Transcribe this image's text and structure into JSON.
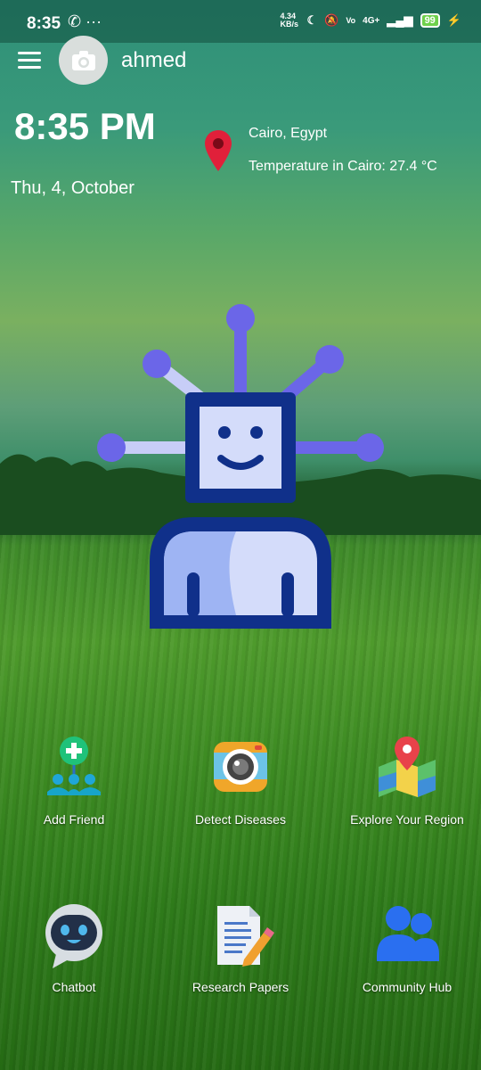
{
  "status_bar": {
    "time": "8:35",
    "network_speed": "4.34 KB/s",
    "network_type": "4G+",
    "battery": "99",
    "icons": [
      "whatsapp-icon",
      "more-dots-icon",
      "moon-icon",
      "mute-icon",
      "volte-icon",
      "signal-icon",
      "charging-icon"
    ]
  },
  "header": {
    "username": "ahmed"
  },
  "clock": {
    "time": "8:35 PM",
    "date": "Thu, 4, October"
  },
  "location": {
    "city": "Cairo, Egypt",
    "temperature": "Temperature in Cairo: 27.4 °C"
  },
  "apps": [
    {
      "label": "Add Friend",
      "icon": "add-friend-icon"
    },
    {
      "label": "Detect Diseases",
      "icon": "camera-icon"
    },
    {
      "label": "Explore Your Region",
      "icon": "map-icon"
    },
    {
      "label": "Chatbot",
      "icon": "chatbot-icon"
    },
    {
      "label": "Research Papers",
      "icon": "document-icon"
    },
    {
      "label": "Community Hub",
      "icon": "community-icon"
    }
  ],
  "colors": {
    "robot_accent": "#6b66e8",
    "robot_frame": "#10308a",
    "pin": "#e0203a"
  }
}
